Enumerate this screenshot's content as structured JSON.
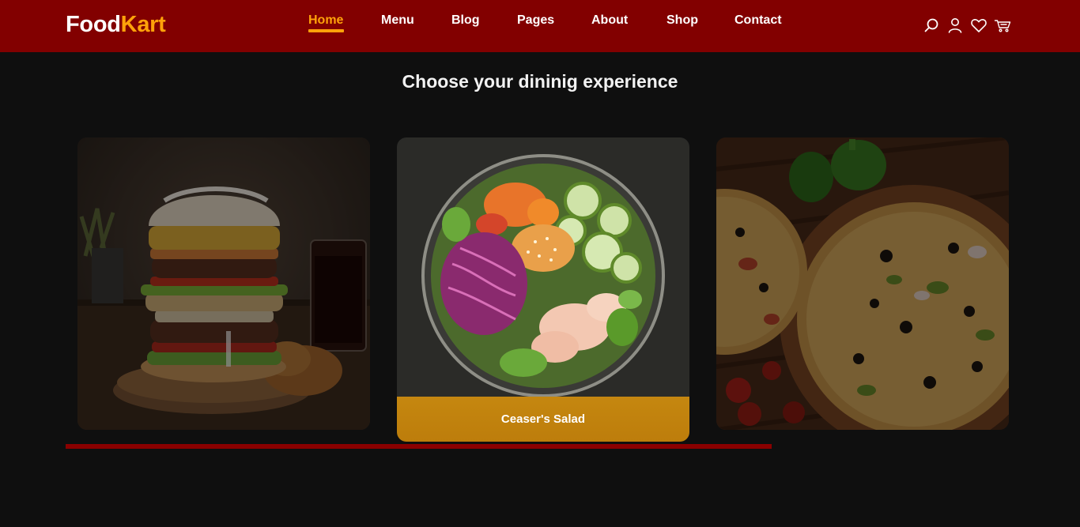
{
  "brand": {
    "part1": "Food",
    "part2": "Kart",
    "accent": "#ffa20a",
    "header_bg": "#820000"
  },
  "nav": {
    "items": [
      {
        "label": "Home",
        "active": true
      },
      {
        "label": "Menu",
        "active": false
      },
      {
        "label": "Blog",
        "active": false
      },
      {
        "label": "Pages",
        "active": false
      },
      {
        "label": "About",
        "active": false
      },
      {
        "label": "Shop",
        "active": false
      },
      {
        "label": "Contact",
        "active": false
      }
    ]
  },
  "header_icons": [
    "search-icon",
    "user-icon",
    "heart-icon",
    "cart-icon"
  ],
  "section": {
    "title": "Choose your dininig experience"
  },
  "cards": [
    {
      "name": "burger",
      "caption": ""
    },
    {
      "name": "salad",
      "caption": "Ceaser's Salad",
      "active": true
    },
    {
      "name": "pizza",
      "caption": ""
    }
  ],
  "carousel": {
    "progress": 1.0,
    "color": "#8a0000"
  }
}
